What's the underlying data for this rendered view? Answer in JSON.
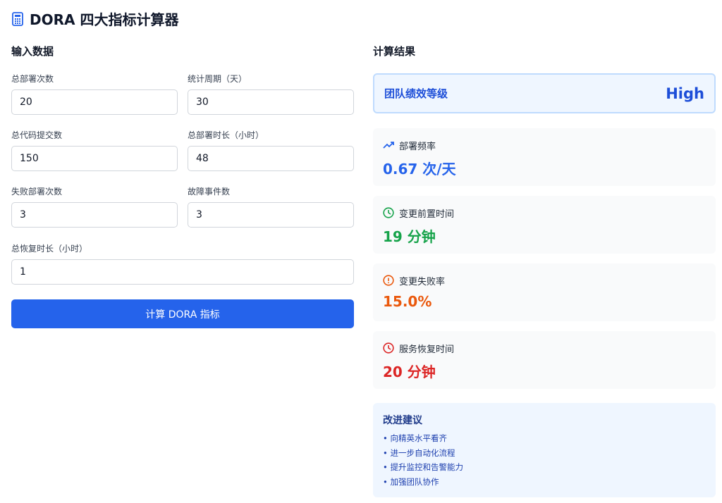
{
  "title": "DORA 四大指标计算器",
  "input_section": {
    "heading": "输入数据",
    "fields": [
      {
        "label": "总部署次数",
        "value": "20"
      },
      {
        "label": "统计周期（天）",
        "value": "30"
      },
      {
        "label": "总代码提交数",
        "value": "150"
      },
      {
        "label": "总部署时长（小时）",
        "value": "48"
      },
      {
        "label": "失败部署次数",
        "value": "3"
      },
      {
        "label": "故障事件数",
        "value": "3"
      },
      {
        "label": "总恢复时长（小时）",
        "value": "1"
      }
    ],
    "button": "计算 DORA 指标"
  },
  "results": {
    "heading": "计算结果",
    "grade": {
      "label": "团队绩效等级",
      "value": "High"
    },
    "metrics": [
      {
        "label": "部署频率",
        "value": "0.67 次/天",
        "color": "#2563eb",
        "icon": "trending-up-icon"
      },
      {
        "label": "变更前置时间",
        "value": "19 分钟",
        "color": "#16a34a",
        "icon": "clock-icon"
      },
      {
        "label": "变更失败率",
        "value": "15.0%",
        "color": "#ea580c",
        "icon": "alert-circle-icon"
      },
      {
        "label": "服务恢复时间",
        "value": "20 分钟",
        "color": "#dc2626",
        "icon": "clock-icon"
      }
    ]
  },
  "suggestions": {
    "heading": "改进建议",
    "items": [
      "向精英水平看齐",
      "进一步自动化流程",
      "提升监控和告警能力",
      "加强团队协作"
    ]
  }
}
